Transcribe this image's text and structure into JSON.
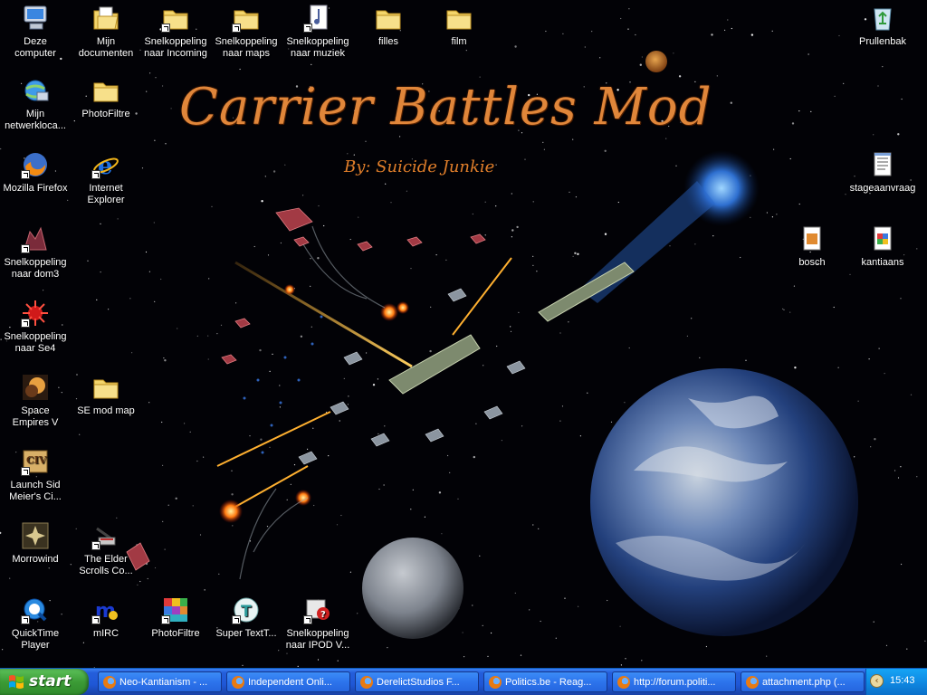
{
  "wallpaper": {
    "title": "Carrier Battles Mod",
    "subtitle": "By: Suicide Junkie"
  },
  "desktop_icons": [
    {
      "label": "Deze computer",
      "icon": "my-computer-icon",
      "shortcut": false
    },
    {
      "label": "Mijn documenten",
      "icon": "my-documents-icon",
      "shortcut": false
    },
    {
      "label": "Snelkoppeling naar Incoming",
      "icon": "folder-icon",
      "shortcut": true
    },
    {
      "label": "Snelkoppeling naar maps",
      "icon": "folder-icon",
      "shortcut": true
    },
    {
      "label": "Snelkoppeling naar muziek",
      "icon": "music-folder-icon",
      "shortcut": true
    },
    {
      "label": "filles",
      "icon": "folder-icon",
      "shortcut": false
    },
    {
      "label": "film",
      "icon": "folder-icon",
      "shortcut": false
    },
    {
      "label": "Prullenbak",
      "icon": "recycle-bin-icon",
      "shortcut": false
    },
    {
      "label": "Mijn netwerkloca...",
      "icon": "network-places-icon",
      "shortcut": false
    },
    {
      "label": "PhotoFiltre",
      "icon": "folder-icon",
      "shortcut": false
    },
    {
      "label": "Mozilla Firefox",
      "icon": "firefox-icon",
      "shortcut": true
    },
    {
      "label": "Internet Explorer",
      "icon": "internet-explorer-icon",
      "shortcut": true
    },
    {
      "label": "stageaanvraag",
      "icon": "text-document-icon",
      "shortcut": false
    },
    {
      "label": "Snelkoppeling naar dom3",
      "icon": "dom3-icon",
      "shortcut": true
    },
    {
      "label": "bosch",
      "icon": "word-document-icon",
      "shortcut": false
    },
    {
      "label": "kantiaans",
      "icon": "word-document-icon",
      "shortcut": false
    },
    {
      "label": "Snelkoppeling naar Se4",
      "icon": "se4-icon",
      "shortcut": true
    },
    {
      "label": "Space Empires V",
      "icon": "space-empires-icon",
      "shortcut": true
    },
    {
      "label": "SE mod map",
      "icon": "folder-icon",
      "shortcut": false
    },
    {
      "label": "Launch Sid Meier's Ci...",
      "icon": "civilization-icon",
      "shortcut": true
    },
    {
      "label": "Morrowind",
      "icon": "morrowind-icon",
      "shortcut": false
    },
    {
      "label": "The Elder Scrolls Co...",
      "icon": "elder-scrolls-icon",
      "shortcut": true
    },
    {
      "label": "QuickTime Player",
      "icon": "quicktime-icon",
      "shortcut": true
    },
    {
      "label": "mIRC",
      "icon": "mirc-icon",
      "shortcut": true
    },
    {
      "label": "PhotoFiltre",
      "icon": "photofiltre-icon",
      "shortcut": true
    },
    {
      "label": "Super TextT...",
      "icon": "super-text-icon",
      "shortcut": true
    },
    {
      "label": "Snelkoppeling naar IPOD V...",
      "icon": "ipod-icon",
      "shortcut": true
    }
  ],
  "taskbar": {
    "start_label": "start",
    "tasks": [
      {
        "label": "Neo-Kantianism - ..."
      },
      {
        "label": "Independent Onli..."
      },
      {
        "label": "DerelictStudios F..."
      },
      {
        "label": "Politics.be - Reag..."
      },
      {
        "label": "http://forum.politi..."
      },
      {
        "label": "attachment.php (..."
      }
    ],
    "clock": "15:43"
  }
}
